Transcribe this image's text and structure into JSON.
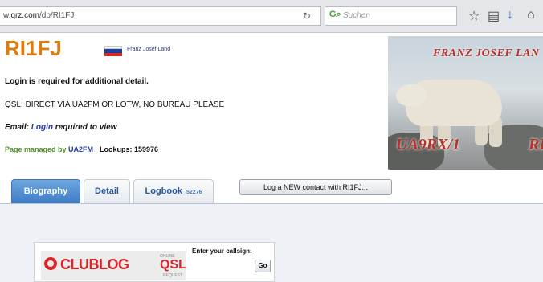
{
  "browser": {
    "url_prefix": "w.",
    "url_domain": "qrz.com",
    "url_path": "/db/RI1FJ",
    "search_placeholder": "Suchen"
  },
  "profile": {
    "callsign": "RI1FJ",
    "location": "Franz Josef Land",
    "login_notice": "Login is required for additional detail.",
    "qsl": "QSL: DIRECT VIA UA2FM OR LOTW, NO BUREAU PLEASE",
    "email_label": "Email: ",
    "email_link": "Login",
    "email_suffix": " required to view",
    "managed_label": "Page managed by ",
    "manager": "UA2FM",
    "lookups": "Lookups: 159976"
  },
  "banner": {
    "top_text": "FRANZ JOSEF LAN",
    "bottom_text": "UA9RX/1",
    "bottom_text_2": "RI"
  },
  "tabs": [
    {
      "label": "Biography"
    },
    {
      "label": "Detail"
    },
    {
      "label": "Logbook",
      "count": "52276"
    }
  ],
  "log_button": "Log a NEW contact with RI1FJ...",
  "clublog": {
    "name": "CLUBLOG",
    "online": "ONLINE",
    "qsl": "QSL",
    "request": "REQUEST",
    "prompt": "Enter your callsign:",
    "go": "Go"
  },
  "colors": {
    "callsign": "#e07b0c",
    "tab_active": "#3e7cc4",
    "banner_text": "#b5322a",
    "clublog_red": "#d8262a"
  }
}
